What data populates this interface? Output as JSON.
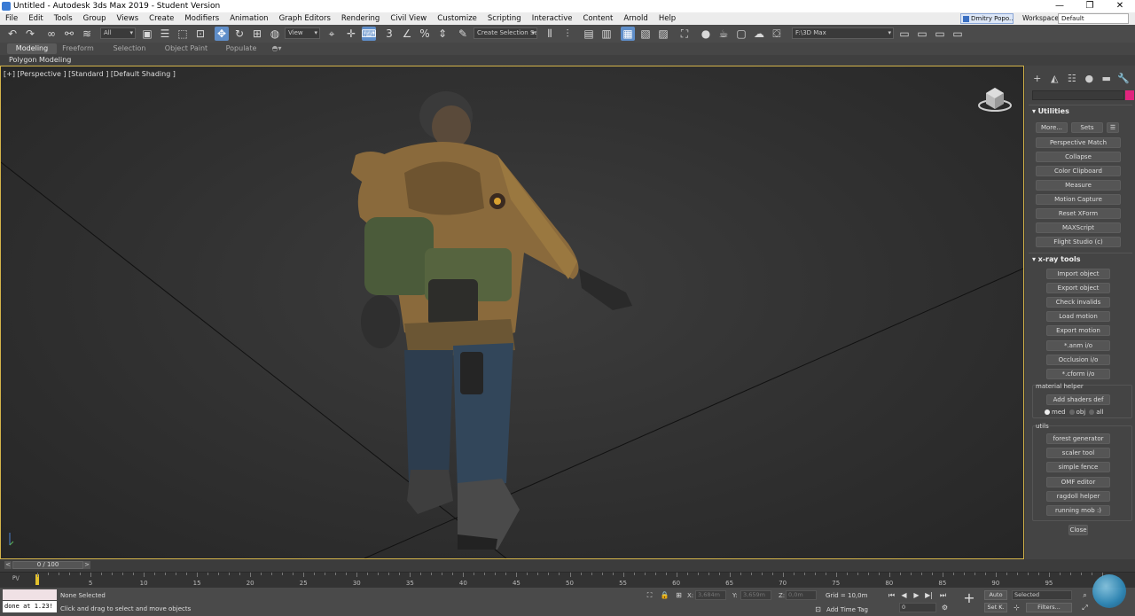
{
  "window": {
    "title": "Untitled - Autodesk 3ds Max 2019 - Student Version"
  },
  "menubar": {
    "items": [
      "File",
      "Edit",
      "Tools",
      "Group",
      "Views",
      "Create",
      "Modifiers",
      "Animation",
      "Graph Editors",
      "Rendering",
      "Civil View",
      "Customize",
      "Scripting",
      "Interactive",
      "Content",
      "Arnold",
      "Help"
    ],
    "user": "Dmitry Popo...",
    "workspaces_label": "Workspaces:",
    "workspace_value": "Default"
  },
  "toolbar": {
    "selection_filter": "All",
    "reference_coord": "View",
    "named_selection": "Create Selection Set",
    "project_path": "F:\\3D Max"
  },
  "ribbon": {
    "tabs": [
      "Modeling",
      "Freeform",
      "Selection",
      "Object Paint",
      "Populate"
    ],
    "active_tab": "Modeling",
    "subpanel": "Polygon Modeling"
  },
  "viewport": {
    "label": "[+] [Perspective ] [Standard ] [Default Shading ]"
  },
  "command_panel": {
    "utilities": {
      "title": "Utilities",
      "more_button": "More...",
      "sets_button": "Sets",
      "buttons": [
        "Perspective Match",
        "Collapse",
        "Color Clipboard",
        "Measure",
        "Motion Capture",
        "Reset XForm",
        "MAXScript",
        "Flight Studio (c)"
      ]
    },
    "xray": {
      "title": "x-ray tools",
      "buttons": [
        "Import object",
        "Export object",
        "Check invalids",
        "Load motion",
        "Export motion",
        "*.anm i/o",
        "Occlusion i/o",
        "*.cform i/o"
      ],
      "material_helper_label": "material helper",
      "add_shaders_button": "Add shaders def",
      "radio_options": [
        "med",
        "obj",
        "all"
      ],
      "radio_selected": "med",
      "utils_label": "utils",
      "utils_buttons": [
        "forest generator",
        "scaler tool",
        "simple fence",
        "OMF editor",
        "ragdoll helper",
        "running mob :)"
      ],
      "close_button": "Close"
    }
  },
  "timeline": {
    "slider_text": "0 / 100",
    "ticks": [
      "5",
      "10",
      "15",
      "20",
      "25",
      "30",
      "35",
      "40",
      "45",
      "50",
      "55",
      "60",
      "65",
      "70",
      "75",
      "80",
      "85",
      "90",
      "95"
    ],
    "track_label": "P\\/"
  },
  "status": {
    "maxscript_output": "done at 1.23!",
    "selection_status": "None Selected",
    "prompt": "Click and drag to select and move objects",
    "x_label": "X:",
    "x_value": "3,684m",
    "y_label": "Y:",
    "y_value": "3,659m",
    "z_label": "Z:",
    "z_value": "0,0m",
    "grid": "Grid = 10,0m",
    "add_time_tag": "Add Time Tag",
    "auto_button": "Auto",
    "setkey_button": "Set K.",
    "key_filter_value": "Selected",
    "filters_button": "Filters...",
    "frame_value": "0"
  }
}
